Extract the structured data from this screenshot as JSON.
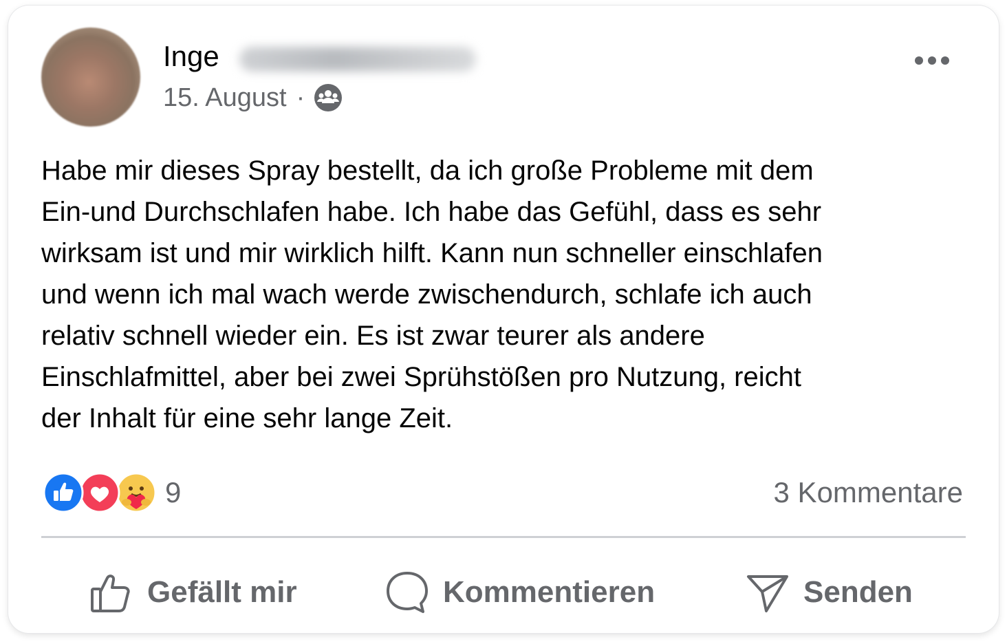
{
  "post": {
    "author": {
      "first_name": "Inge"
    },
    "date": "15. August",
    "separator": "·",
    "audience_icon": "group-audience-icon",
    "text": "Habe mir dieses Spray bestellt, da ich große Probleme mit dem\nEin-und Durchschlafen habe. Ich habe das Gefühl, dass es sehr\nwirksam ist und mir wirklich hilft. Kann nun schneller einschlafen\nund wenn ich mal wach werde zwischendurch, schlafe ich auch\nrelativ schnell wieder ein. Es ist zwar teurer als andere\nEinschlafmittel, aber bei zwei Sprühstößen pro Nutzung, reicht\nder Inhalt für eine sehr lange Zeit.",
    "reactions": {
      "icons": [
        "like-icon",
        "love-icon",
        "care-icon"
      ],
      "count": "9"
    },
    "comments_label": "3 Kommentare"
  },
  "actions": {
    "like_label": "Gefällt mir",
    "comment_label": "Kommentieren",
    "share_label": "Senden"
  },
  "colors": {
    "like_blue": "#1877f2",
    "love_red": "#f33e58",
    "secondary_text": "#65676b",
    "primary_text": "#050505"
  }
}
